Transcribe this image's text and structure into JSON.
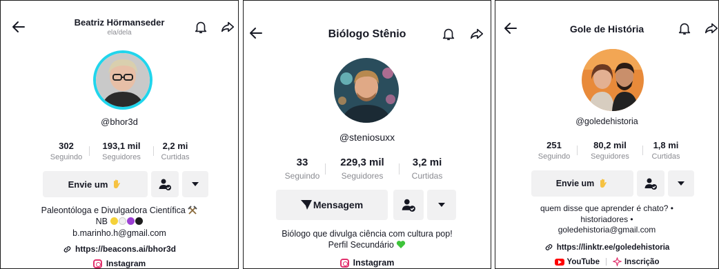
{
  "profiles": [
    {
      "name": "Beatriz Hörmanseder",
      "pronouns": "ela/dela",
      "handle": "@bhor3d",
      "stats": [
        {
          "value": "302",
          "label": "Seguindo"
        },
        {
          "value": "193,1 mil",
          "label": "Seguidores"
        },
        {
          "value": "2,2 mi",
          "label": "Curtidas"
        }
      ],
      "message_button": "Envie um",
      "bio_line1": "Paleontóloga e Divulgadora Científica",
      "bio_line2": "NB",
      "bio_line3": "b.marinho.h@gmail.com",
      "link": "https://beacons.ai/bhor3d",
      "social": "Instagram"
    },
    {
      "name": "Biólogo Stênio",
      "handle": "@steniosuxx",
      "stats": [
        {
          "value": "33",
          "label": "Seguindo"
        },
        {
          "value": "229,3 mil",
          "label": "Seguidores"
        },
        {
          "value": "3,2 mi",
          "label": "Curtidas"
        }
      ],
      "message_button": "Mensagem",
      "bio_line1": "Biólogo que divulga ciência com cultura pop!",
      "bio_line2": "Perfil Secundário",
      "social": "Instagram"
    },
    {
      "name": "Gole de História",
      "handle": "@goledehistoria",
      "stats": [
        {
          "value": "251",
          "label": "Seguindo"
        },
        {
          "value": "80,2 mil",
          "label": "Seguidores"
        },
        {
          "value": "1,8 mi",
          "label": "Curtidas"
        }
      ],
      "message_button": "Envie um",
      "bio_line1": "quem disse que aprender é chato? •",
      "bio_line2": "historiadores •",
      "bio_line3": "goledehistoria@gmail.com",
      "link": "https://linktr.ee/goledehistoria",
      "social1": "YouTube",
      "social2": "Inscrição"
    }
  ],
  "icons": {
    "back": "arrow-left-icon",
    "notify": "bell-icon",
    "share": "share-arrow-icon",
    "friends": "user-check-icon",
    "more": "caret-down-icon",
    "wave": "waving-hand-icon",
    "message": "send-icon",
    "link": "link-icon",
    "instagram": "instagram-icon",
    "youtube": "youtube-icon"
  },
  "colors": {
    "avatar_ring": "#20d5ec",
    "text": "#161823",
    "muted": "#8a8b91",
    "button_bg": "#f1f1f2"
  }
}
